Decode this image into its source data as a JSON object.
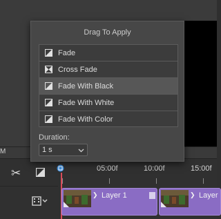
{
  "background": {
    "side_label": "M"
  },
  "popup": {
    "title": "Drag To Apply",
    "transitions": [
      {
        "label": "Fade",
        "icon": "fade-icon",
        "selected": false
      },
      {
        "label": "Cross Fade",
        "icon": "cross-fade-icon",
        "selected": false
      },
      {
        "label": "Fade With Black",
        "icon": "fade-icon",
        "selected": true
      },
      {
        "label": "Fade With White",
        "icon": "fade-icon",
        "selected": false
      },
      {
        "label": "Fade With Color",
        "icon": "fade-icon",
        "selected": false
      }
    ],
    "duration_label": "Duration:",
    "duration_value": "1 s"
  },
  "timeline": {
    "ruler_labels": [
      "05:00f",
      "10:00f",
      "15:00f"
    ],
    "clips": [
      {
        "label": "Layer 1"
      },
      {
        "label": "Layer"
      }
    ],
    "colors": {
      "clip": "#8a6cc4",
      "playhead": "#d94b5a",
      "playhead_knob": "#3d8fe0"
    }
  }
}
